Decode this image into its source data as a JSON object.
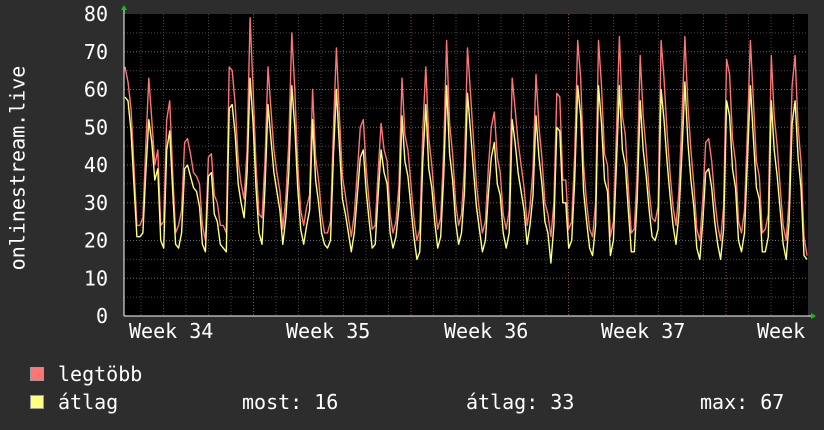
{
  "chart_data": {
    "type": "line",
    "ylabel": "onlinestream.live",
    "ylim": [
      0,
      80
    ],
    "yticks": [
      0,
      10,
      20,
      30,
      40,
      50,
      60,
      70,
      80
    ],
    "xlabels": [
      "Week 34",
      "Week 35",
      "Week 36",
      "Week 37",
      "Week"
    ],
    "grid": true,
    "legend_placement": "bottom-left",
    "series": [
      {
        "name": "legtöbb",
        "color": "#ff7474",
        "values": [
          66,
          62,
          55,
          40,
          24,
          24,
          26,
          45,
          63,
          52,
          40,
          44,
          24,
          25,
          52,
          57,
          38,
          22,
          24,
          28,
          46,
          47,
          43,
          38,
          37,
          35,
          24,
          20,
          42,
          43,
          32,
          30,
          24,
          24,
          22,
          66,
          65,
          56,
          41,
          35,
          31,
          44,
          79,
          60,
          40,
          27,
          26,
          41,
          66,
          55,
          44,
          38,
          33,
          23,
          31,
          46,
          75,
          60,
          40,
          28,
          24,
          29,
          32,
          60,
          42,
          36,
          27,
          22,
          22,
          25,
          50,
          71,
          53,
          37,
          32,
          26,
          21,
          27,
          38,
          50,
          52,
          39,
          30,
          23,
          24,
          38,
          51,
          44,
          41,
          27,
          22,
          25,
          35,
          63,
          48,
          44,
          35,
          26,
          20,
          23,
          49,
          66,
          47,
          40,
          30,
          23,
          26,
          44,
          73,
          51,
          43,
          30,
          24,
          27,
          40,
          71,
          59,
          47,
          35,
          28,
          22,
          25,
          39,
          50,
          54,
          42,
          38,
          27,
          23,
          28,
          63,
          55,
          46,
          40,
          34,
          24,
          29,
          39,
          64,
          50,
          42,
          30,
          27,
          21,
          30,
          59,
          58,
          36,
          36,
          23,
          25,
          43,
          73,
          63,
          40,
          30,
          23,
          21,
          30,
          73,
          61,
          43,
          40,
          21,
          25,
          48,
          74,
          53,
          48,
          34,
          22,
          23,
          38,
          69,
          53,
          44,
          33,
          26,
          25,
          29,
          73,
          63,
          49,
          38,
          29,
          24,
          33,
          52,
          74,
          56,
          44,
          35,
          23,
          20,
          31,
          46,
          47,
          41,
          31,
          24,
          20,
          29,
          68,
          64,
          47,
          41,
          25,
          22,
          28,
          49,
          73,
          57,
          41,
          37,
          22,
          23,
          27,
          69,
          53,
          45,
          34,
          24,
          20,
          31,
          61,
          69,
          50,
          41,
          21,
          16
        ]
      },
      {
        "name": "átlag",
        "color": "#ffff80",
        "values": [
          58,
          57,
          49,
          35,
          21,
          21,
          22,
          38,
          52,
          46,
          36,
          39,
          20,
          18,
          44,
          49,
          33,
          19,
          18,
          22,
          39,
          40,
          37,
          34,
          33,
          29,
          19,
          17,
          37,
          38,
          27,
          25,
          19,
          18,
          17,
          55,
          56,
          48,
          35,
          30,
          26,
          38,
          63,
          51,
          34,
          22,
          19,
          34,
          56,
          47,
          38,
          33,
          28,
          19,
          26,
          38,
          61,
          50,
          34,
          23,
          19,
          24,
          28,
          52,
          36,
          30,
          22,
          19,
          18,
          20,
          43,
          60,
          45,
          31,
          27,
          22,
          17,
          22,
          32,
          42,
          44,
          33,
          25,
          18,
          19,
          32,
          44,
          38,
          35,
          22,
          18,
          21,
          29,
          53,
          41,
          37,
          29,
          21,
          15,
          17,
          41,
          56,
          39,
          34,
          25,
          18,
          21,
          37,
          61,
          43,
          36,
          25,
          19,
          22,
          33,
          59,
          49,
          39,
          29,
          23,
          17,
          20,
          32,
          42,
          46,
          35,
          32,
          22,
          18,
          22,
          52,
          46,
          38,
          33,
          28,
          19,
          24,
          32,
          53,
          42,
          35,
          25,
          22,
          14,
          24,
          50,
          49,
          30,
          30,
          18,
          20,
          36,
          61,
          53,
          33,
          25,
          18,
          16,
          24,
          61,
          51,
          36,
          33,
          16,
          20,
          40,
          61,
          44,
          40,
          28,
          17,
          17,
          31,
          57,
          44,
          37,
          28,
          21,
          20,
          23,
          60,
          52,
          41,
          32,
          24,
          19,
          27,
          43,
          62,
          46,
          36,
          29,
          18,
          15,
          25,
          38,
          39,
          34,
          25,
          19,
          15,
          23,
          57,
          53,
          39,
          34,
          20,
          17,
          22,
          41,
          61,
          47,
          34,
          31,
          17,
          17,
          21,
          57,
          44,
          37,
          28,
          19,
          15,
          25,
          51,
          57,
          42,
          34,
          16,
          15
        ]
      }
    ],
    "stats": {
      "most_label": "most:",
      "most_value": "16",
      "atlag_label": "átlag:",
      "atlag_value": "33",
      "max_label": "max:",
      "max_value": "67"
    }
  }
}
